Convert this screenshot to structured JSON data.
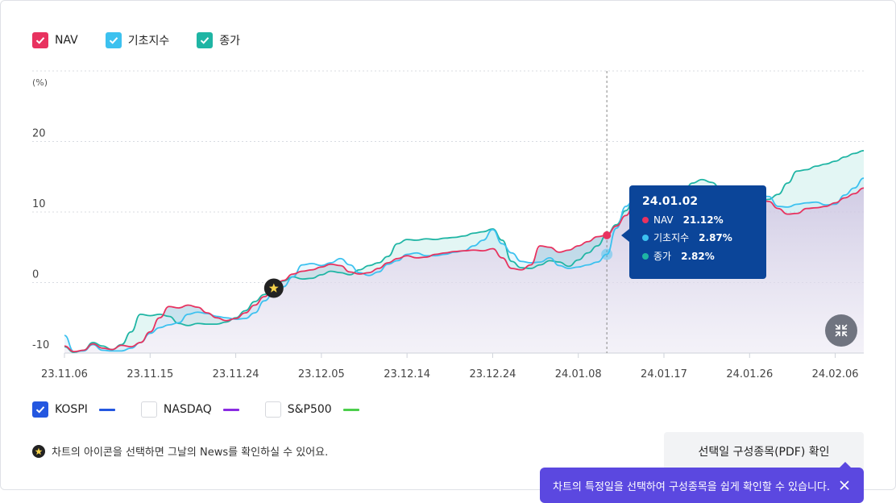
{
  "legend_top": [
    {
      "label": "NAV",
      "color": "#e8325f",
      "checked": true
    },
    {
      "label": "기초지수",
      "color": "#3cc1ef",
      "checked": true
    },
    {
      "label": "종가",
      "color": "#1fb5a4",
      "checked": true
    }
  ],
  "legend_bottom": [
    {
      "label": "KOSPI",
      "color": "#2457e0",
      "checked": true
    },
    {
      "label": "NASDAQ",
      "color": "#8a2be2",
      "checked": false
    },
    {
      "label": "S&P500",
      "color": "#4ccf4c",
      "checked": false
    }
  ],
  "tooltip": {
    "date": "24.01.02",
    "rows": [
      {
        "label": "NAV",
        "value": "21.12%",
        "color": "#e8325f"
      },
      {
        "label": "기초지수",
        "value": "2.87%",
        "color": "#3cc1ef"
      },
      {
        "label": "종가",
        "value": "2.82%",
        "color": "#1fb5a4"
      }
    ]
  },
  "note": "차트의 아이콘을 선택하면 그날의 News를 확인하실 수 있어요.",
  "pdf_button": "선택일 구성종목(PDF) 확인",
  "hint": "차트의 특정일을 선택하여 구성종목을 쉽게 확인할 수 있습니다.",
  "chart_data": {
    "type": "line",
    "ylabel": "(%)",
    "ylim": [
      -10,
      30
    ],
    "yticks": [
      -10,
      0,
      10,
      20
    ],
    "x_ticks": [
      "23.11.06",
      "23.11.15",
      "23.11.24",
      "23.12.05",
      "23.12.14",
      "23.12.24",
      "24.01.08",
      "24.01.17",
      "24.01.26",
      "24.02.06"
    ],
    "x_tick_index": [
      0,
      9,
      18,
      27,
      36,
      45,
      54,
      63,
      72,
      81
    ],
    "grid": true,
    "selected_index": 57,
    "news_marker_index": 22,
    "series": [
      {
        "name": "NAV",
        "color": "#e8325f",
        "values": [
          -9,
          -9.8,
          -9.6,
          -8.7,
          -9.3,
          -9.5,
          -8.9,
          -9.1,
          -8.5,
          -7,
          -5,
          -3.4,
          -3.6,
          -3.2,
          -3.5,
          -4.3,
          -5,
          -5.4,
          -5.1,
          -4.3,
          -3.2,
          -2,
          -0.8,
          0.3,
          1.2,
          1.6,
          1.8,
          2.2,
          2.6,
          2.4,
          1.5,
          1.2,
          1.4,
          2,
          2.8,
          3.4,
          3.8,
          3.5,
          3.6,
          4,
          4.2,
          4.4,
          4.5,
          4.6,
          4.5,
          4.8,
          3.5,
          2,
          1.8,
          2.5,
          5.2,
          5,
          4.3,
          4.6,
          5.2,
          5.8,
          6.5,
          6.7,
          8,
          9.5,
          11.6,
          12.1,
          11.5,
          11.7,
          12.3,
          12.9,
          12.5,
          11.2,
          12.6,
          12.5,
          11.4,
          11,
          11.2,
          11.8,
          11.5,
          10.5,
          9.7,
          9.8,
          10.5,
          10.6,
          10.8,
          11.3,
          12,
          12.6,
          13.4
        ]
      },
      {
        "name": "기초지수",
        "color": "#3cc1ef",
        "values": [
          -7.5,
          -9.8,
          -9.7,
          -8.8,
          -9.6,
          -9.7,
          -9.7,
          -9.3,
          -8.5,
          -7.2,
          -6.4,
          -6,
          -5.7,
          -4.5,
          -4.2,
          -4.4,
          -4.8,
          -5,
          -5.2,
          -5.1,
          -4.3,
          -2.6,
          -1.5,
          -0.6,
          0.8,
          2.5,
          2.7,
          2.4,
          2.8,
          3.4,
          2.5,
          1.4,
          1,
          1.5,
          2.6,
          3.1,
          4,
          4.2,
          3.8,
          3.8,
          4,
          4.3,
          4.5,
          5.2,
          6,
          7.5,
          5.5,
          4.2,
          3,
          2.8,
          2.9,
          3.5,
          2.4,
          2,
          2.2,
          2.5,
          2.9,
          4,
          7.7,
          10.8,
          12.3,
          12.7,
          12.4,
          12.1,
          12.2,
          12.1,
          12.3,
          11.6,
          12.6,
          13,
          11.6,
          12.2,
          12.5,
          12.3,
          12.2,
          10.8,
          10.7,
          11.1,
          11.3,
          11.4,
          11,
          11.1,
          12.4,
          13.4,
          14.8
        ]
      },
      {
        "name": "종가",
        "color": "#1fb5a4",
        "values": [
          -9.1,
          -9.9,
          -9.6,
          -8.5,
          -9,
          -9.5,
          -8.8,
          -7,
          -4.5,
          -4.7,
          -4.5,
          -4.8,
          -5.8,
          -6.1,
          -5.8,
          -5.9,
          -5.9,
          -5.6,
          -5,
          -4,
          -2.7,
          -1.7,
          -0.5,
          0.2,
          0.8,
          0.5,
          0.6,
          1.1,
          1.6,
          1.4,
          1.1,
          1.8,
          2.4,
          2.8,
          3.7,
          5.5,
          6.1,
          6,
          6.2,
          6.1,
          6.3,
          6.4,
          6.6,
          7,
          7.2,
          7.6,
          6,
          3,
          2.1,
          2,
          2.5,
          3.1,
          2.9,
          2.3,
          3.2,
          4.2,
          5.2,
          6.8,
          8.2,
          10.2,
          12.5,
          13.3,
          13.6,
          13.5,
          13.2,
          12.7,
          14.1,
          14.6,
          14.2,
          13.3,
          12.3,
          11.9,
          11.5,
          11.6,
          11.8,
          12.5,
          14.1,
          15.8,
          16,
          16.5,
          16.8,
          17.2,
          17.8,
          18.3,
          18.7
        ]
      }
    ]
  }
}
